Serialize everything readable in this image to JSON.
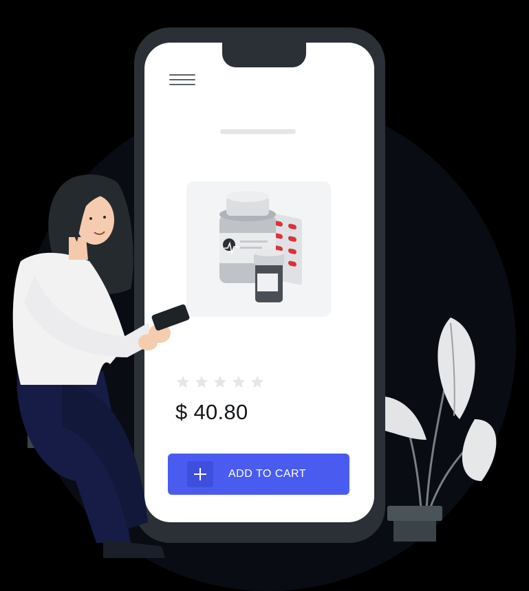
{
  "product": {
    "image_icon": "medicine-bottles-icon",
    "rating": {
      "filled": 0,
      "total": 5
    },
    "price": "$ 40.80"
  },
  "actions": {
    "add_to_cart_label": "ADD TO CART",
    "add_icon": "plus-icon"
  },
  "header": {
    "menu_icon": "hamburger-icon"
  },
  "colors": {
    "accent": "#4a5cf0",
    "phone_frame": "#2a3036",
    "star_empty": "#e4e6ea",
    "background": "#000000"
  }
}
